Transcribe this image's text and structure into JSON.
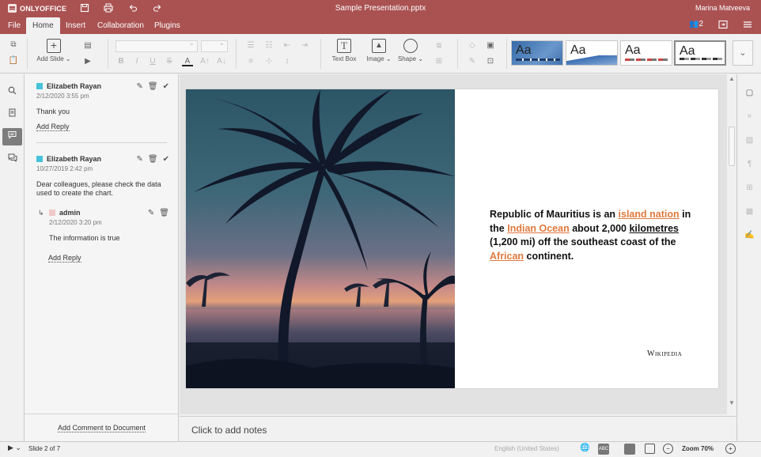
{
  "app": {
    "logo_text": "ONLYOFFICE",
    "doc_title": "Sample Presentation.pptx",
    "user_name": "Marina Matveeva",
    "users_count": "2",
    "accent_color": "#aa5252"
  },
  "tabs": [
    {
      "label": "File"
    },
    {
      "label": "Home"
    },
    {
      "label": "Insert"
    },
    {
      "label": "Collaboration"
    },
    {
      "label": "Plugins"
    }
  ],
  "toolbar": {
    "add_slide_label": "Add Slide",
    "textbox_label": "Text Box",
    "image_label": "Image",
    "shape_label": "Shape",
    "bold": "B",
    "italic": "I",
    "underline": "U",
    "strike": "S",
    "fontcolor": "A",
    "themes": [
      {
        "label": "Aa"
      },
      {
        "label": "Aa"
      },
      {
        "label": "Aa"
      },
      {
        "label": "Aa"
      }
    ]
  },
  "comments": {
    "items": [
      {
        "author": "Elizabeth Rayan",
        "date": "2/12/2020 3:55 pm",
        "text": "Thank you",
        "add_reply": "Add Reply"
      },
      {
        "author": "Elizabeth Rayan",
        "date": "10/27/2019 2:42 pm",
        "text": "Dear colleagues, please check the data used to create the chart.",
        "reply": {
          "author": "admin",
          "date": "2/12/2020 3:20 pm",
          "text": "The information is true"
        },
        "add_reply": "Add Reply"
      }
    ],
    "add_to_document": "Add Comment to Document"
  },
  "slide": {
    "text_parts": {
      "p1": "Republic of Mauritius is an ",
      "l1": "island nation",
      "p2": " in the ",
      "l2": "Indian Ocean",
      "p3": " about 2,000 ",
      "u1": "kilometres",
      "p4": " (1,200 mi) off the southeast coast of the ",
      "l3": "African",
      "p5": " continent."
    },
    "attribution": "Wikipedia"
  },
  "notes_placeholder": "Click to add notes",
  "status": {
    "slide_info": "Slide 2 of 7",
    "language": "English (United States)",
    "zoom": "Zoom 70%"
  }
}
